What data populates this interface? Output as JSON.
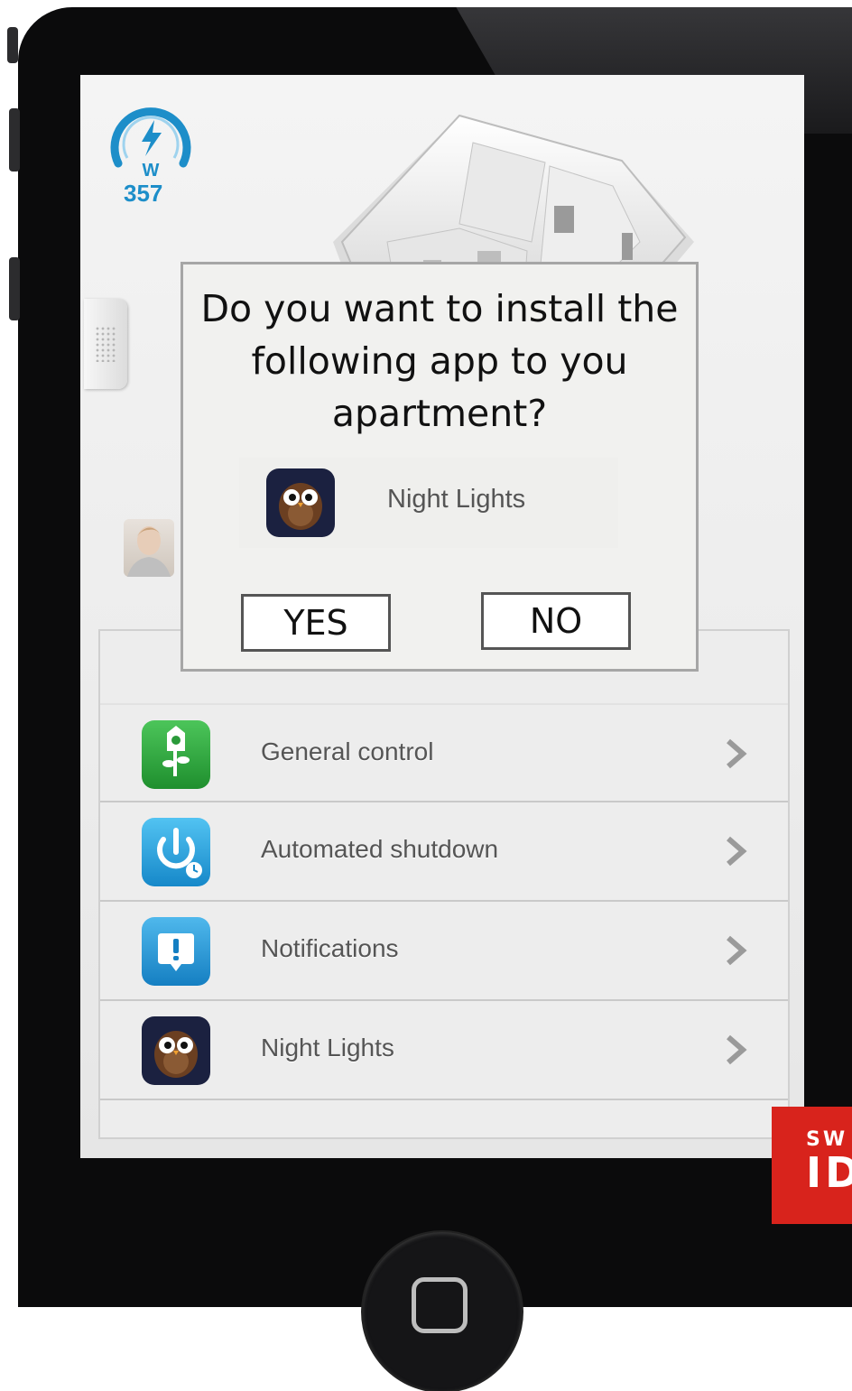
{
  "power_meter": {
    "value": "357",
    "unit": "W",
    "icon": "lightning-icon"
  },
  "dialog": {
    "message": "Do you want to install the following app to you apartment?",
    "app": {
      "name": "Night Lights",
      "icon": "owl-icon"
    },
    "yes_label": "YES",
    "no_label": "NO"
  },
  "menu": {
    "items": [
      {
        "label": "General control",
        "icon": "house-flower-icon"
      },
      {
        "label": "Automated shutdown",
        "icon": "power-timer-icon"
      },
      {
        "label": "Notifications",
        "icon": "exclamation-bubble-icon"
      },
      {
        "label": "Night Lights",
        "icon": "owl-icon"
      }
    ]
  },
  "badge": {
    "line1": "SW",
    "line2": "ID"
  },
  "colors": {
    "accent_blue": "#1d8ec9",
    "badge_red": "#d8231c",
    "screen_bg": "#f0f0f0",
    "phone_body": "#0b0b0c"
  }
}
